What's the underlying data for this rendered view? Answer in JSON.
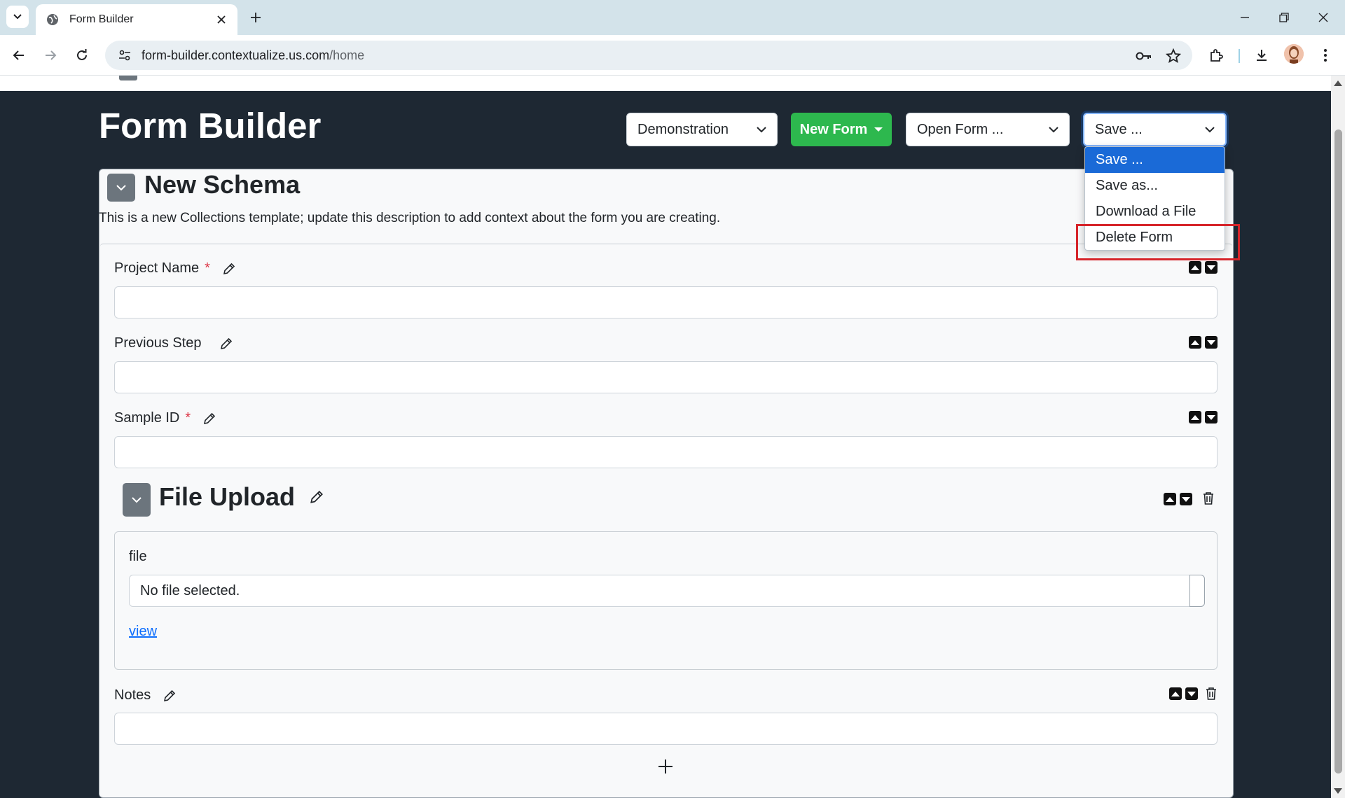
{
  "browser": {
    "tab_title": "Form Builder",
    "url_host": "form-builder.contextualize.us.com",
    "url_path": "/home"
  },
  "header": {
    "title": "Form Builder",
    "project_select": "Demonstration",
    "new_form_label": "New Form",
    "open_form_select": "Open Form ...",
    "save_select": "Save ..."
  },
  "save_menu": {
    "options": [
      "Save ...",
      "Save as...",
      "Download a File",
      "Delete Form"
    ],
    "selected_index": 0,
    "highlighted_option": "Delete Form"
  },
  "schema": {
    "title": "New Schema",
    "description": "This is a new Collections template; update this description to add context about the form you are creating.",
    "fields": [
      {
        "label": "Project Name",
        "required": "*",
        "value": ""
      },
      {
        "label": "Previous Step",
        "required": "",
        "value": ""
      },
      {
        "label": "Sample ID",
        "required": "*",
        "value": ""
      }
    ],
    "file_section": {
      "title": "File Upload",
      "file_label": "file",
      "file_status": "No file selected.",
      "view_link": "view"
    },
    "notes_field": {
      "label": "Notes",
      "value": ""
    },
    "add_label": "+"
  },
  "colors": {
    "page_bg": "#1e2833",
    "new_form_btn": "#2db84e",
    "selected_option": "#1a6ad7",
    "highlight_box": "#d6242a",
    "required": "#dc3545"
  },
  "icons": [
    "tab-search-icon",
    "globe-icon",
    "close-icon",
    "plus-icon",
    "minimize-icon",
    "restore-icon",
    "back-icon",
    "forward-icon",
    "reload-icon",
    "site-info-icon",
    "key-icon",
    "star-icon",
    "extensions-icon",
    "download-icon",
    "avatar",
    "chevron-down-icon",
    "pencil-icon",
    "arrow-up-icon",
    "arrow-down-icon",
    "trash-icon"
  ]
}
